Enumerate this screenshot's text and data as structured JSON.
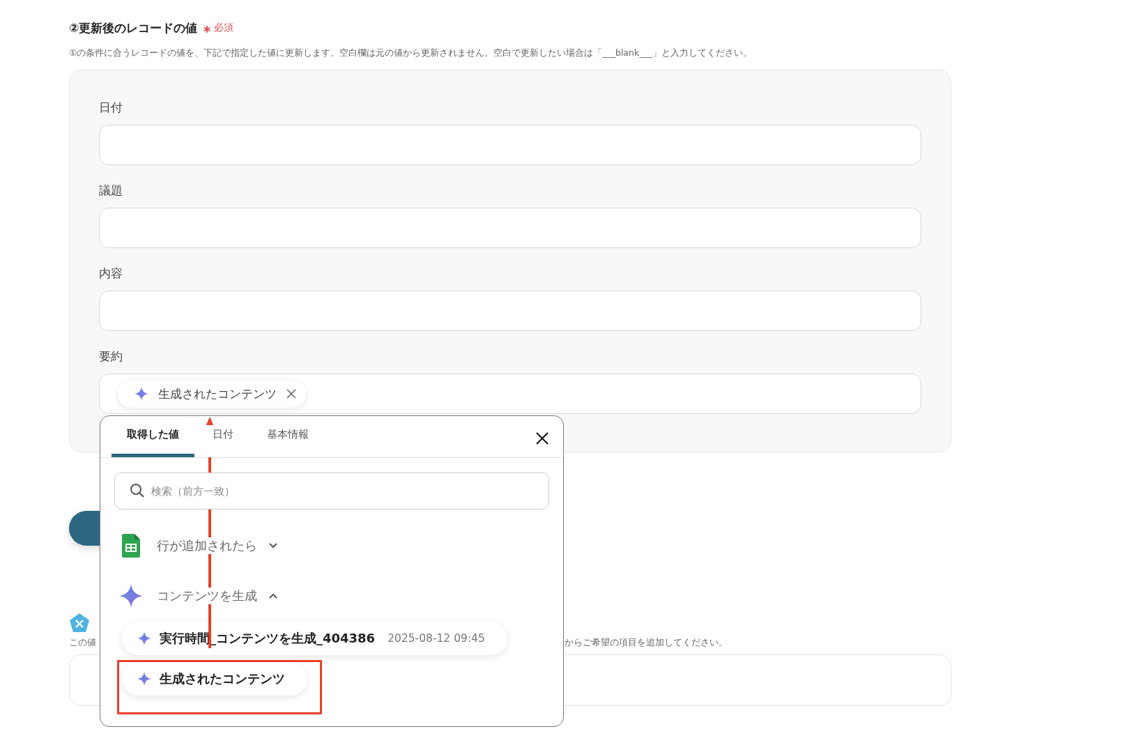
{
  "section": {
    "title": "②更新後のレコードの値",
    "required": "必須",
    "description": "①の条件に合うレコードの値を、下記で指定した値に更新します。空白欄は元の値から更新されません。空白で更新したい場合は「___blank___」と入力してください。"
  },
  "fields": [
    {
      "label": "日付"
    },
    {
      "label": "議題"
    },
    {
      "label": "内容"
    },
    {
      "label": "要約",
      "chip": "生成されたコンテンツ"
    }
  ],
  "below": {
    "note_start": "この値",
    "note_end": "からご希望の項目を追加してください。"
  },
  "popup": {
    "tabs": [
      {
        "label": "取得した値",
        "selected": true
      },
      {
        "label": "日付",
        "selected": false
      },
      {
        "label": "基本情報",
        "selected": false
      }
    ],
    "search": {
      "placeholder": "検索（前方一致）"
    },
    "groups": [
      {
        "kind": "sheets",
        "title": "行が追加されたら",
        "expanded": false
      },
      {
        "kind": "ai",
        "title": "コンテンツを生成",
        "expanded": true,
        "items": [
          {
            "label": "実行時間_コンテンツを生成_404386",
            "time": "2025-08-12 09:45",
            "highlighted": false
          },
          {
            "label": "生成されたコンテンツ",
            "highlighted": true
          }
        ]
      }
    ]
  }
}
